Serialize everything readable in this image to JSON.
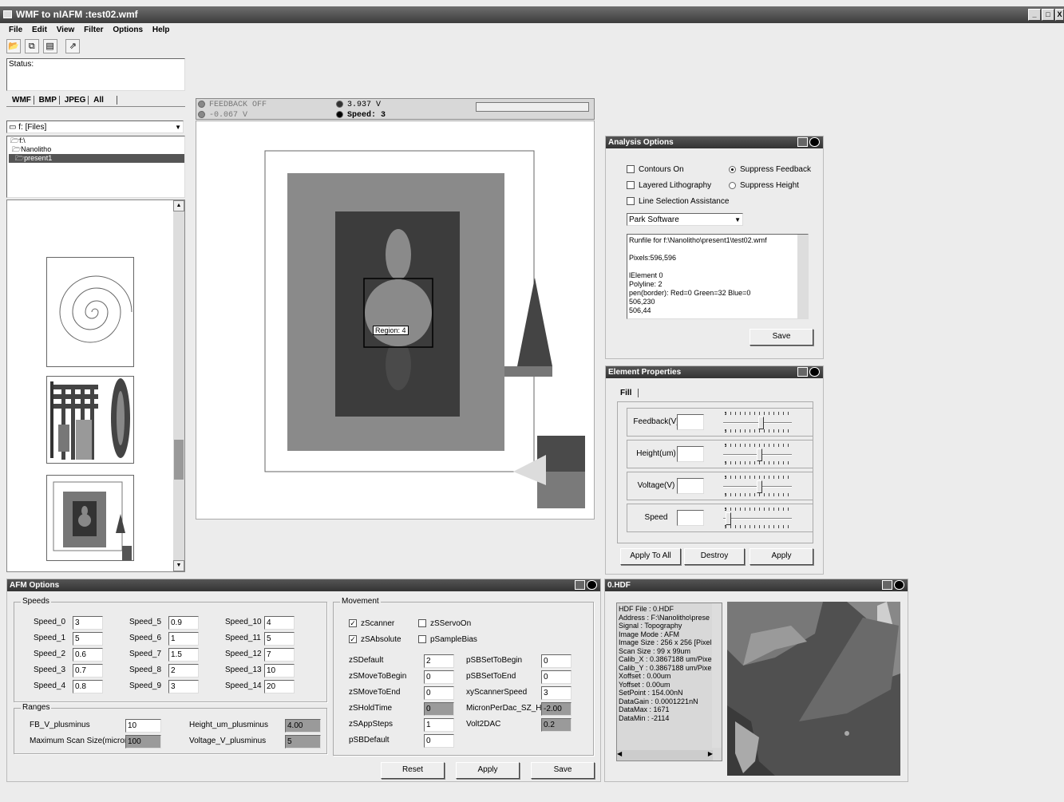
{
  "window": {
    "title": "WMF to nIAFM :test02.wmf",
    "buttons": [
      "_",
      "□",
      "X"
    ]
  },
  "menu": [
    "File",
    "Edit",
    "View",
    "Filter",
    "Options",
    "Help"
  ],
  "toolbar": {
    "icons": [
      "open-icon",
      "copy-icon",
      "paste-icon",
      "export-icon"
    ]
  },
  "status": {
    "label": "Status:"
  },
  "file_tabs": [
    "WMF",
    "BMP",
    "JPEG",
    "All"
  ],
  "drive": {
    "selected": "f: [Files]"
  },
  "folders": [
    "f:\\",
    "Nanolitho",
    "present1"
  ],
  "indicators": {
    "feedback": "FEEDBACK OFF",
    "feedback_value": "-0.067 V",
    "voltage": "3.937 V",
    "speed": "Speed: 3"
  },
  "canvas": {
    "region_label": "Region: 4"
  },
  "analysis": {
    "title": "Analysis Options",
    "contours_on": "Contours On",
    "layered_litho": "Layered Lithography",
    "line_selection": "Line Selection Assistance",
    "suppress_feedback": "Suppress Feedback",
    "suppress_height": "Suppress Height",
    "software_selected": "Park Software",
    "runfile_lines": [
      "Runfile for f:\\Nanolitho\\present1\\test02.wmf",
      "",
      "Pixels:596,596",
      "",
      "lElement 0",
      "Polyline: 2",
      "pen(border): Red=0 Green=32 Blue=0",
      "506,230",
      "506,44"
    ],
    "save_label": "Save"
  },
  "element": {
    "title": "Element Properties",
    "tab": "Fill",
    "rows": [
      {
        "label": "Feedback(V)",
        "level": 0.55
      },
      {
        "label": "Height(um)",
        "level": 0.52
      },
      {
        "label": "Voltage(V)",
        "level": 0.52
      },
      {
        "label": "Speed",
        "level": 0.04
      }
    ],
    "apply_all": "Apply To All",
    "destroy": "Destroy",
    "apply": "Apply"
  },
  "afm": {
    "title": "AFM Options",
    "speeds_title": "Speeds",
    "speeds": [
      {
        "label": "Speed_0",
        "value": "3"
      },
      {
        "label": "Speed_1",
        "value": "5"
      },
      {
        "label": "Speed_2",
        "value": "0.6"
      },
      {
        "label": "Speed_3",
        "value": "0.7"
      },
      {
        "label": "Speed_4",
        "value": "0.8"
      },
      {
        "label": "Speed_5",
        "value": "0.9"
      },
      {
        "label": "Speed_6",
        "value": "1"
      },
      {
        "label": "Speed_7",
        "value": "1.5"
      },
      {
        "label": "Speed_8",
        "value": "2"
      },
      {
        "label": "Speed_9",
        "value": "3"
      },
      {
        "label": "Speed_10",
        "value": "4"
      },
      {
        "label": "Speed_11",
        "value": "5"
      },
      {
        "label": "Speed_12",
        "value": "7"
      },
      {
        "label": "Speed_13",
        "value": "10"
      },
      {
        "label": "Speed_14",
        "value": "20"
      }
    ],
    "ranges_title": "Ranges",
    "fb_label": "FB_V_plusminus",
    "fb_value": "10",
    "maxscan_label": "Maximum Scan Size(microns)",
    "maxscan_value": "100",
    "height_label": "Height_um_plusminus",
    "height_value": "4.00",
    "voltage_label": "Voltage_V_plusminus",
    "voltage_value": "5",
    "movement_title": "Movement",
    "zscanner": "zScanner",
    "zservo": "zSServoOn",
    "zabsolute": "zSAbsolute",
    "psample": "pSampleBias",
    "left_fields": [
      {
        "label": "zSDefault",
        "value": "2",
        "gray": false
      },
      {
        "label": "zSMoveToBegin",
        "value": "0",
        "gray": false
      },
      {
        "label": "zSMoveToEnd",
        "value": "0",
        "gray": false
      },
      {
        "label": "zSHoldTime",
        "value": "0",
        "gray": true
      },
      {
        "label": "zSAppSteps",
        "value": "1",
        "gray": false
      },
      {
        "label": "pSBDefault",
        "value": "0",
        "gray": false
      }
    ],
    "right_fields": [
      {
        "label": "pSBSetToBegin",
        "value": "0",
        "gray": false
      },
      {
        "label": "pSBSetToEnd",
        "value": "0",
        "gray": false
      },
      {
        "label": "xyScannerSpeed",
        "value": "3",
        "gray": false
      },
      {
        "label": "MicronPerDac_SZ_Hi",
        "value": "-2.00",
        "gray": true
      },
      {
        "label": "Volt2DAC",
        "value": "0.2",
        "gray": true
      }
    ],
    "reset": "Reset",
    "apply": "Apply",
    "save": "Save"
  },
  "hdf": {
    "title": "0.HDF",
    "lines": [
      "HDF File : 0.HDF",
      "Address : F:\\Nanolitho\\prese",
      "Signal : Topography",
      "Image Mode : AFM",
      "Image Size : 256 x 256 [Pixel",
      "Scan Size : 99 x 99um",
      "Calib_X : 0.3867188 um/Pixe",
      "Calib_Y : 0.3867188 um/Pixe",
      "Xoffset : 0.00um",
      "Yoffset : 0.00um",
      "SetPoint : 154.00nN",
      "DataGain : 0.0001221nN",
      "DataMax : 1671",
      "DataMin : -2114"
    ]
  }
}
